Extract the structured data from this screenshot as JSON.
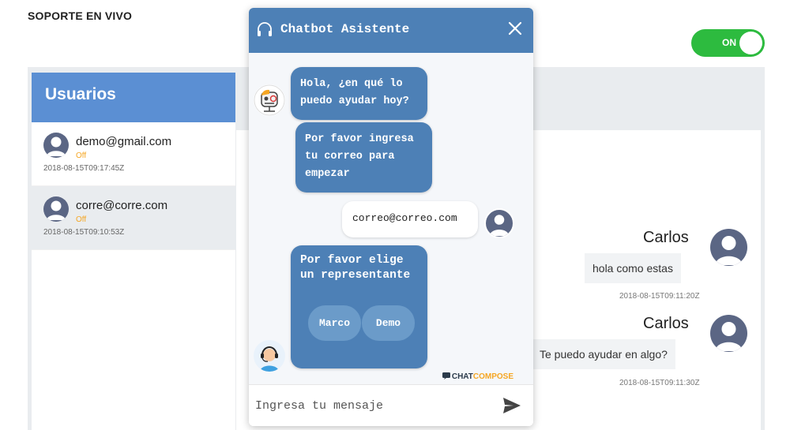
{
  "page": {
    "title": "SOPORTE EN VIVO"
  },
  "toggle": {
    "label": "ON",
    "state": "on",
    "color": "#2dbb3f"
  },
  "users": {
    "header": "Usuarios",
    "items": [
      {
        "email": "demo@gmail.com",
        "status": "Off",
        "date": "2018-08-15T09:17:45Z",
        "active": false
      },
      {
        "email": "corre@corre.com",
        "status": "Off",
        "date": "2018-08-15T09:10:53Z",
        "active": true
      }
    ]
  },
  "conversation": {
    "messages": [
      {
        "name": "Carlos",
        "text": "hola como estas",
        "date": "2018-08-15T09:11:20Z"
      },
      {
        "name": "Carlos",
        "text": "Te puedo ayudar en algo?",
        "date": "2018-08-15T09:11:30Z"
      }
    ]
  },
  "chatbot": {
    "title": "Chatbot Asistente",
    "header_color": "#4d80b6",
    "messages": {
      "bot_greeting": "Hola, ¿en qué lo puedo ayudar hoy?",
      "bot_email_request": "Por favor ingresa tu correo para empezar",
      "user_email": "correo@correo.com",
      "bot_rep_request": "Por favor elige un representante"
    },
    "options": [
      "Marco",
      "Demo"
    ],
    "brand": {
      "part1": "CHAT",
      "part2": "COMPOSE"
    },
    "input_placeholder": "Ingresa tu mensaje",
    "icons": {
      "header": "headset-icon",
      "close": "close-icon",
      "send": "send-icon"
    }
  }
}
